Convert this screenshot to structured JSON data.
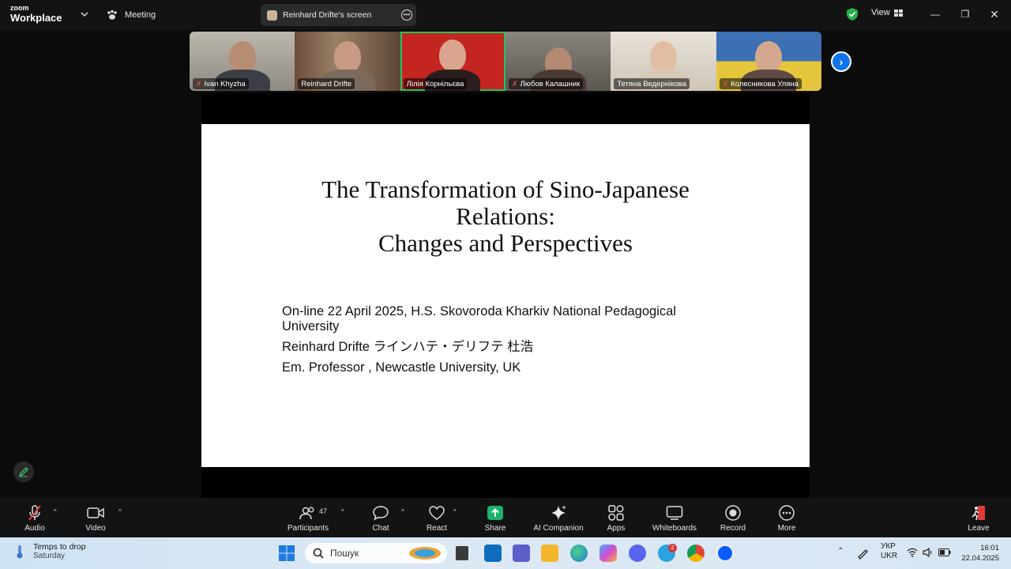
{
  "app": {
    "brand_top": "zoom",
    "brand_bottom": "Workplace",
    "meeting_label": "Meeting",
    "sharing_label": "Reinhard Drifte's screen",
    "view_label": "View"
  },
  "participants": [
    {
      "name": "Ivan Khyzha",
      "muted": true
    },
    {
      "name": "Reinhard Drifte",
      "muted": false
    },
    {
      "name": "Лілія Корнільєва",
      "muted": false,
      "active": true
    },
    {
      "name": "Любов Калашник",
      "muted": true
    },
    {
      "name": "Тетяна Ведернікова",
      "muted": false
    },
    {
      "name": "Колесникова Уляна",
      "muted": true
    }
  ],
  "slide": {
    "title_line1": "The Transformation of Sino-Japanese",
    "title_line2": "Relations:",
    "title_line3": "Changes and Perspectives",
    "event_line1": "On-line 22 April 2025, H.S. Skovoroda Kharkiv National Pedagogical",
    "event_line2": "University",
    "author_name": "Reinhard Drifte",
    "author_katakana": "ラインハテ・デリフテ",
    "author_kanji": "杜浩",
    "affiliation": "Em. Professor , Newcastle University, UK"
  },
  "toolbar": {
    "audio": "Audio",
    "video": "Video",
    "participants": "Participants",
    "participants_count": "47",
    "chat": "Chat",
    "react": "React",
    "share": "Share",
    "ai_companion": "AI Companion",
    "apps": "Apps",
    "whiteboards": "Whiteboards",
    "record": "Record",
    "more": "More",
    "leave": "Leave"
  },
  "taskbar": {
    "weather_title": "Temps to drop",
    "weather_sub": "Saturday",
    "search_placeholder": "Пошук",
    "lang_top": "УКР",
    "lang_bottom": "UKR",
    "time": "16:01",
    "date": "22.04.2025",
    "telegram_badge": "2"
  },
  "colors": {
    "accent": "#0e72ed",
    "active_border": "#23c55e",
    "share_green": "#19b36b",
    "mute_red": "#f04a4a"
  }
}
